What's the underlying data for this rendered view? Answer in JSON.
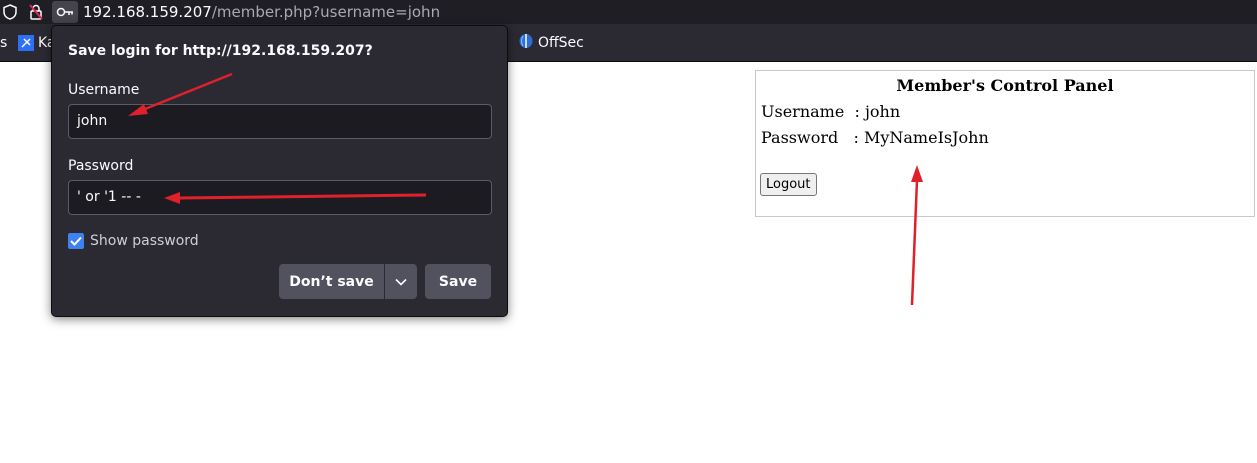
{
  "browser": {
    "url_host": "192.168.159.207",
    "url_path": "/member.php?username=john",
    "icons": [
      "shield-icon",
      "lock-slash-icon",
      "key-icon"
    ]
  },
  "bookmarks": [
    {
      "label": "s"
    },
    {
      "label": "Ka",
      "icon": "kali-icon"
    },
    {
      "label": "OffSec",
      "icon": "offsec-icon"
    }
  ],
  "popup": {
    "title": "Save login for http://192.168.159.207?",
    "username_label": "Username",
    "username_value": "john",
    "password_label": "Password",
    "password_value": "' or '1 -- -",
    "show_password_label": "Show password",
    "show_password_checked": true,
    "dont_save_label": "Don’t save",
    "save_label": "Save"
  },
  "panel": {
    "title": "Member's Control Panel",
    "username_row": "Username  : john",
    "password_row": "Password   : MyNameIsJohn",
    "logout_label": "Logout"
  },
  "colors": {
    "accent": "#3d82ee",
    "annotation_arrow": "#e0202a",
    "popup_bg": "#2b2a33"
  }
}
